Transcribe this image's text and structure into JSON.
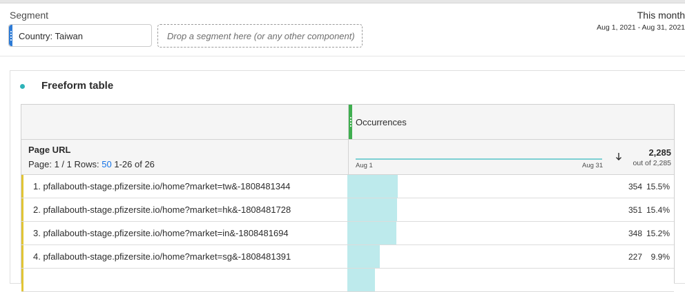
{
  "segment": {
    "label": "Segment",
    "chip_label": "Country: Taiwan",
    "drop_placeholder": "Drop a segment here (or any other component)"
  },
  "date": {
    "title": "This month",
    "range": "Aug 1, 2021 - Aug 31, 2021"
  },
  "panel": {
    "title": "Freeform table"
  },
  "table": {
    "metric": "Occurrences",
    "dimension": "Page URL",
    "pagination": {
      "page_text": "Page: 1 / 1",
      "rows_label": "Rows:",
      "rows_value": "50",
      "range_text": "1-26 of 26"
    },
    "sparkline": {
      "start_label": "Aug 1",
      "end_label": "Aug 31"
    },
    "total": {
      "value": "2,285",
      "sub": "out of 2,285"
    },
    "rows": [
      {
        "label": "1. pfallabouth-stage.pfizersite.io/home?market=tw&-1808481344",
        "value": "354",
        "percent": "15.5%",
        "share": 0.155
      },
      {
        "label": "2. pfallabouth-stage.pfizersite.io/home?market=hk&-1808481728",
        "value": "351",
        "percent": "15.4%",
        "share": 0.154
      },
      {
        "label": "3. pfallabouth-stage.pfizersite.io/home?market=in&-1808481694",
        "value": "348",
        "percent": "15.2%",
        "share": 0.152
      },
      {
        "label": "4. pfallabouth-stage.pfizersite.io/home?market=sg&-1808481391",
        "value": "227",
        "percent": "9.9%",
        "share": 0.099
      },
      {
        "label": "",
        "value": "",
        "percent": "",
        "share": 0.085
      }
    ]
  },
  "colors": {
    "accent_blue": "#1473e6",
    "segment_grip": "#2d7bd6",
    "metric_grip": "#3fae4f",
    "row_marker": "#e2c535",
    "bar_fill": "#bdeaec",
    "sparkline": "#7ccfd3",
    "panel_dot": "#2db3b8"
  },
  "icons": {
    "segment_grip": "drag-handle-icon",
    "metric_grip": "drag-handle-icon",
    "sort": "arrow-down-icon"
  }
}
